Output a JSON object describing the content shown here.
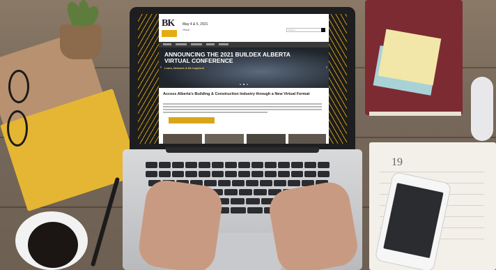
{
  "site": {
    "logo_letters": "BK",
    "event_date": "May 4 & 5, 2021",
    "venue": "Virtual",
    "search_placeholder": "Search",
    "hero_title": "ANNOUNCING THE 2021 BUILDEX ALBERTA VIRTUAL CONFERENCE",
    "hero_subtitle": "Learn, Network & Be Inspired!",
    "section_heading": "Access Alberta's Building & Construction Industry through a New Virtual Format",
    "journal_number": "19"
  },
  "colors": {
    "brand_gold": "#d8a619",
    "nav_dark": "#3a3a3a",
    "laptop_bezel": "#1e1e20"
  }
}
